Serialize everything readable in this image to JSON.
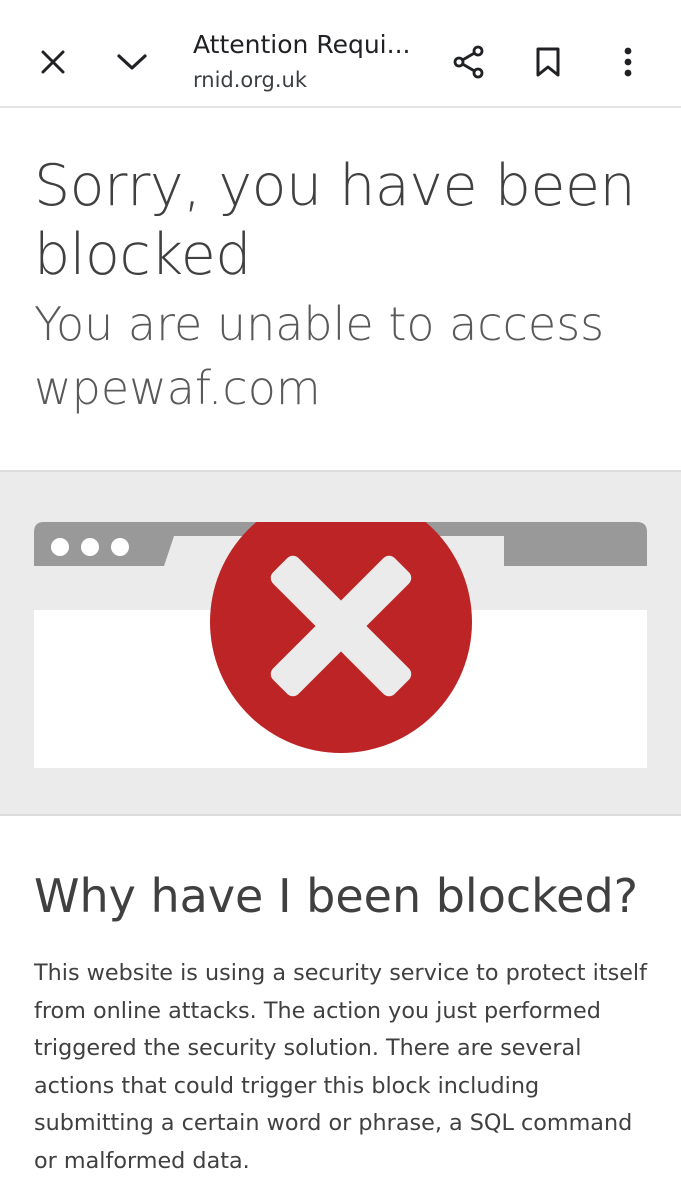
{
  "browser_bar": {
    "title": "Attention Requi...",
    "url": "rnid.org.uk",
    "icons": {
      "close": "close-icon",
      "minimize": "chevron-down-icon",
      "share": "share-icon",
      "bookmark": "bookmark-icon",
      "more": "more-vert-icon"
    }
  },
  "page": {
    "heading": "Sorry, you have been blocked",
    "subheading": "You are unable to access wpewaf.com",
    "illustration": {
      "description_icon": "blocked-x-icon",
      "accent_color": "#bd2426"
    },
    "why": {
      "title": "Why have I been blocked?",
      "body": "This website is using a security service to protect itself from online attacks. The action you just performed triggered the security solution. There are several actions that could trigger this block including submitting a certain word or phrase, a SQL command or malformed data."
    }
  }
}
